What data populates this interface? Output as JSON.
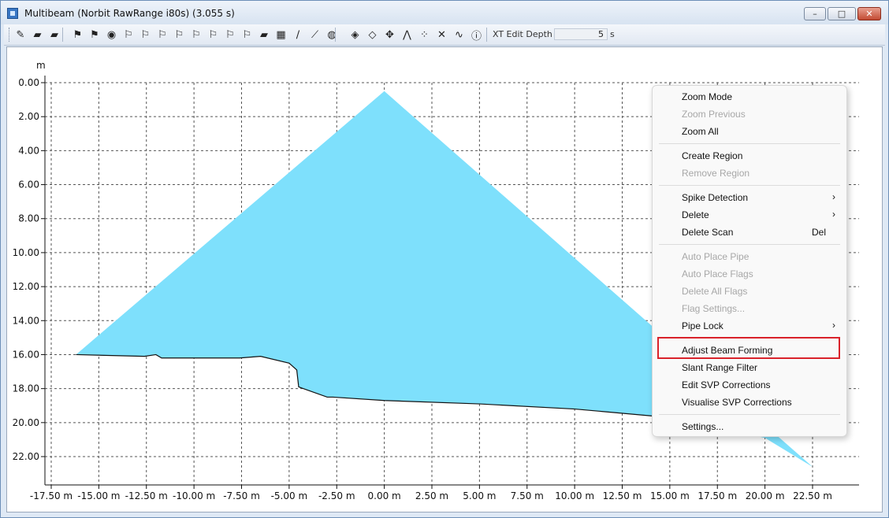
{
  "window": {
    "title": "Multibeam (Norbit RawRange i80s) (3.055 s)",
    "buttons": [
      "minimize",
      "maximize",
      "close"
    ]
  },
  "toolbar": {
    "icons": [
      "pen-icon",
      "eraser-icon",
      "brush-icon",
      "flag-black-icon",
      "flag-icon",
      "circle-flag-icon",
      "flag-marker-icon",
      "flag-outline-icon",
      "flag-outline-icon",
      "flag-outline-icon",
      "flag-outline-icon",
      "flag-outline-icon",
      "flag-outline-icon",
      "flag-outline-icon",
      "wand-icon",
      "grid-select-icon",
      "pencil-line-icon",
      "ruler-icon",
      "globe-icon",
      "diamond-icon",
      "diamond-outline-icon",
      "move-arrows-icon",
      "beam-fan-icon",
      "scatter-icon",
      "x-spike-icon",
      "waveform-icon",
      "info-icon"
    ],
    "xt_edit_label": "XT Edit Depth",
    "xt_edit_value": "5",
    "xt_edit_unit": "s"
  },
  "chart_data": {
    "type": "area",
    "title": "",
    "ylabel": "m",
    "xlabel": "",
    "xlim": [
      -17.5,
      22.5
    ],
    "ylim": [
      0,
      22
    ],
    "y_inverted": true,
    "grid": true,
    "fill_color": "#7ee0fc",
    "x_ticks": [
      "-17.50 m",
      "-15.00 m",
      "-12.50 m",
      "-10.00 m",
      "-7.50 m",
      "-5.00 m",
      "-2.50 m",
      "0.00 m",
      "2.50 m",
      "5.00 m",
      "7.50 m",
      "10.00 m",
      "12.50 m",
      "15.00 m",
      "17.50 m",
      "20.00 m",
      "22.50 m"
    ],
    "y_ticks": [
      "0.00",
      "2.00",
      "4.00",
      "6.00",
      "8.00",
      "10.00",
      "12.00",
      "14.00",
      "16.00",
      "18.00",
      "20.00",
      "22.00"
    ],
    "apex": {
      "x": 0.0,
      "y": 0.5
    },
    "seabed_profile": [
      {
        "x": -16.2,
        "y": 16.0
      },
      {
        "x": -12.6,
        "y": 16.1
      },
      {
        "x": -12.0,
        "y": 16.0
      },
      {
        "x": -11.7,
        "y": 16.2
      },
      {
        "x": -7.6,
        "y": 16.2
      },
      {
        "x": -6.5,
        "y": 16.1
      },
      {
        "x": -5.0,
        "y": 16.5
      },
      {
        "x": -4.6,
        "y": 16.9
      },
      {
        "x": -4.5,
        "y": 17.9
      },
      {
        "x": -3.0,
        "y": 18.5
      },
      {
        "x": -2.7,
        "y": 18.5
      },
      {
        "x": 0.0,
        "y": 18.7
      },
      {
        "x": 5.0,
        "y": 18.9
      },
      {
        "x": 10.0,
        "y": 19.2
      },
      {
        "x": 15.0,
        "y": 19.7
      },
      {
        "x": 20.0,
        "y": 20.9
      },
      {
        "x": 22.5,
        "y": 22.6
      }
    ]
  },
  "context_menu": {
    "items": [
      {
        "label": "Zoom Mode",
        "enabled": true
      },
      {
        "label": "Zoom Previous",
        "enabled": false
      },
      {
        "label": "Zoom All",
        "enabled": true
      },
      {
        "sep": true
      },
      {
        "label": "Create Region",
        "enabled": true
      },
      {
        "label": "Remove Region",
        "enabled": false
      },
      {
        "sep": true
      },
      {
        "label": "Spike Detection",
        "enabled": true,
        "submenu": true
      },
      {
        "label": "Delete",
        "enabled": true,
        "submenu": true
      },
      {
        "label": "Delete Scan",
        "enabled": true,
        "shortcut": "Del"
      },
      {
        "sep": true
      },
      {
        "label": "Auto Place Pipe",
        "enabled": false
      },
      {
        "label": "Auto Place Flags",
        "enabled": false
      },
      {
        "label": "Delete All Flags",
        "enabled": false
      },
      {
        "label": "Flag Settings...",
        "enabled": false
      },
      {
        "label": "Pipe Lock",
        "enabled": true,
        "submenu": true
      },
      {
        "sep": true
      },
      {
        "label": "Adjust Beam Forming",
        "enabled": true,
        "highlighted": true
      },
      {
        "label": "Slant Range Filter",
        "enabled": true
      },
      {
        "label": "Edit SVP Corrections",
        "enabled": true
      },
      {
        "label": "Visualise SVP Corrections",
        "enabled": true
      },
      {
        "sep": true
      },
      {
        "label": "Settings...",
        "enabled": true
      }
    ],
    "arrow_glyph": "›"
  }
}
